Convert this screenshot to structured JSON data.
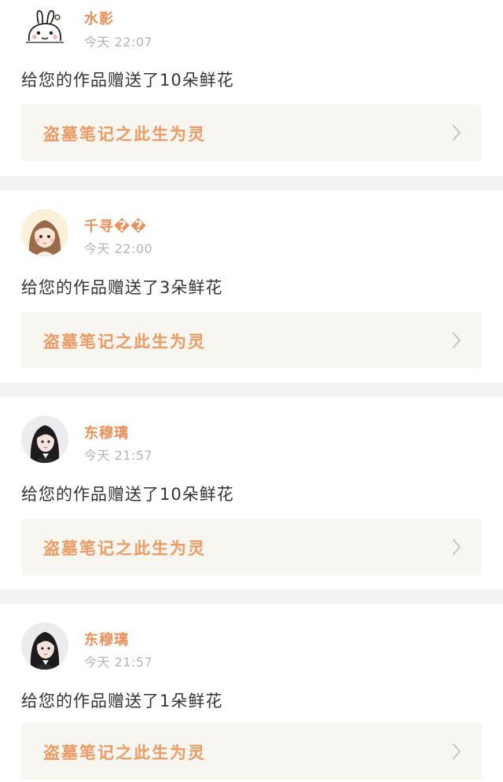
{
  "notifications": [
    {
      "username": "水影",
      "timestamp": "今天 22:07",
      "message": "给您的作品赠送了10朵鲜花",
      "work_title": "盗墓笔记之此生为灵",
      "avatar_icon": "cartoon-rabbit-avatar"
    },
    {
      "username": "千寻��",
      "timestamp": "今天 22:00",
      "message": "给您的作品赠送了3朵鲜花",
      "work_title": "盗墓笔记之此生为灵",
      "avatar_icon": "anime-girl-avatar"
    },
    {
      "username": "东穆璃",
      "timestamp": "今天 21:57",
      "message": "给您的作品赠送了10朵鲜花",
      "work_title": "盗墓笔记之此生为灵",
      "avatar_icon": "girl-photo-avatar"
    },
    {
      "username": "东穆璃",
      "timestamp": "今天 21:57",
      "message": "给您的作品赠送了1朵鲜花",
      "work_title": "盗墓笔记之此生为灵",
      "avatar_icon": "girl-photo-avatar"
    }
  ],
  "colors": {
    "username": "#ee8f57",
    "work_title": "#ee9a63",
    "timestamp": "#b5b5b5",
    "message": "#333333",
    "link_background": "#f7f6f0",
    "divider": "#f4f3f1",
    "chevron": "#c4c4c4"
  }
}
